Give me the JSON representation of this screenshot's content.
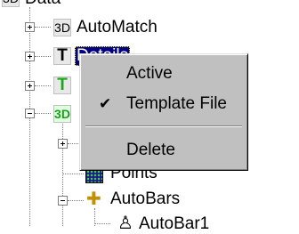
{
  "tree": {
    "root_label": "Data",
    "root_icon": "3d-icon",
    "nodes": [
      {
        "label": "AutoMatch",
        "icon_text": "3D"
      },
      {
        "label": "Details",
        "icon_text": "T"
      },
      {
        "label": "",
        "icon_text": "T"
      },
      {
        "label": "",
        "icon_text": "3D"
      },
      {
        "label": "Points"
      },
      {
        "label": "AutoBars"
      },
      {
        "label": "AutoBar1"
      }
    ]
  },
  "context_menu": {
    "items": [
      {
        "label": "Active",
        "checked": false
      },
      {
        "label": "Template File",
        "checked": true,
        "check_glyph": "✔"
      },
      {
        "label": "Delete",
        "checked": false
      }
    ]
  },
  "colors": {
    "selection_bg": "#000080",
    "menu_bg": "#c0c0c0",
    "green_icon": "#18a818"
  }
}
